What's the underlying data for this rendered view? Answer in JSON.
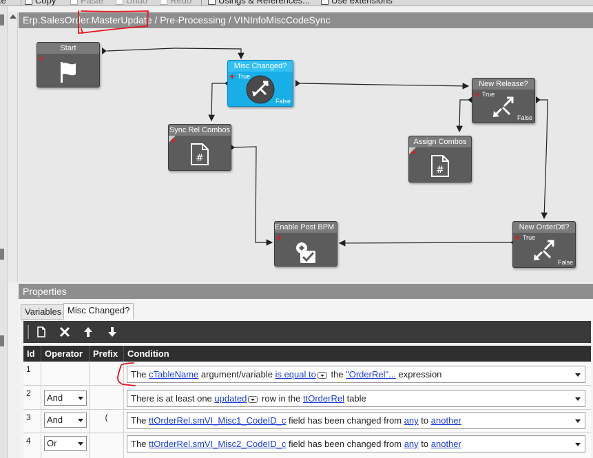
{
  "toolbar": {
    "items": [
      {
        "label": "te",
        "enabled": true
      },
      {
        "label": "Copy",
        "enabled": true
      },
      {
        "label": "Paste",
        "enabled": false
      },
      {
        "label": "Undo",
        "enabled": false
      },
      {
        "label": "Redo",
        "enabled": false
      },
      {
        "label": "Usings & References...",
        "enabled": true
      },
      {
        "label": "Use extensions",
        "enabled": true
      }
    ]
  },
  "breadcrumb": {
    "part1": "Erp.SalesOrder.",
    "part2": "MasterUpdate",
    "sep1": " / ",
    "part3": "Pre-Processing",
    "sep2": " / ",
    "part4": "VINInfoMiscCodeSync"
  },
  "workflow": {
    "nodes": {
      "start": {
        "title": "Start"
      },
      "misc": {
        "title": "Misc Changed?",
        "true_label": "True",
        "false_label": "False"
      },
      "newrelease": {
        "title": "New Release?",
        "true_label": "True",
        "false_label": "False"
      },
      "assign": {
        "title": "Assign Combos"
      },
      "syncrel": {
        "title": "Sync Rel Combos"
      },
      "enablepost": {
        "title": "Enable Post BPM R"
      },
      "neworderdtl": {
        "title": "New OrderDtl?",
        "true_label": "True",
        "false_label": "False"
      }
    }
  },
  "properties": {
    "header": "Properties",
    "tabs": [
      {
        "label": "Variables",
        "active": false
      },
      {
        "label": "Misc Changed?",
        "active": true
      }
    ],
    "columns": {
      "id": "Id",
      "operator": "Operator",
      "prefix": "Prefix",
      "condition": "Condition"
    },
    "rows": [
      {
        "id": "1",
        "operator": "",
        "prefix": "",
        "c": {
          "t1": "The ",
          "l1": "cTableName",
          "t2": " argument/variable ",
          "l2": "is equal to",
          "t3": " the ",
          "l3": "\"OrderRel\"...",
          "t4": " expression"
        }
      },
      {
        "id": "2",
        "operator": "And",
        "prefix": "",
        "c": {
          "t1": "There is at least one ",
          "l1": "updated",
          "t2": " row in the ",
          "l2": "ttOrderRel",
          "t3": " table"
        }
      },
      {
        "id": "3",
        "operator": "And",
        "prefix": "(",
        "c": {
          "t1": "The ",
          "l1": "ttOrderRel.smVI_Misc1_CodeID_c",
          "t2": " field has been changed from ",
          "l2": "any",
          "t3": " to ",
          "l3": "another"
        }
      },
      {
        "id": "4",
        "operator": "Or",
        "prefix": "",
        "c": {
          "t1": "The ",
          "l1": "ttOrderRel.smVI_Misc2_CodeID_c",
          "t2": " field has been changed from ",
          "l2": "any",
          "t3": " to ",
          "l3": "another"
        }
      }
    ]
  },
  "colors": {
    "selected_node": "#18aee8",
    "node": "#5c5c5c",
    "link": "#1a3ed6",
    "annotation": "#e8141e"
  }
}
